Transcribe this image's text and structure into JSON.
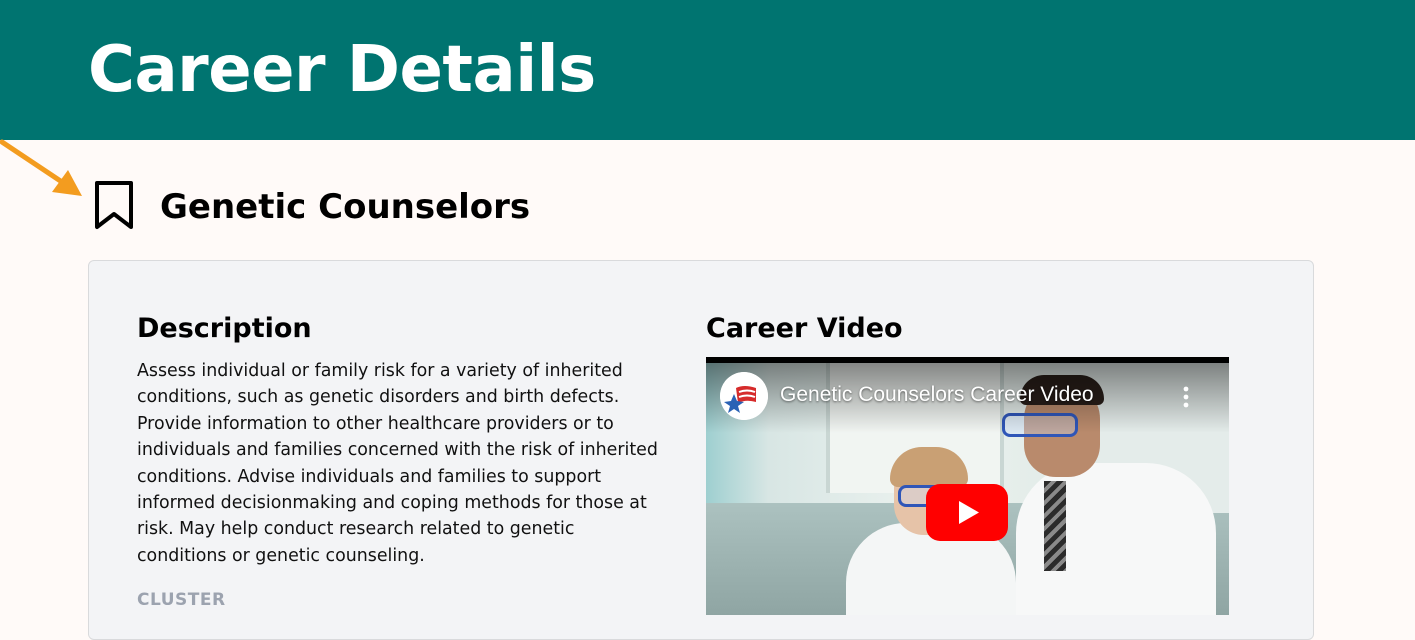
{
  "header": {
    "title": "Career Details"
  },
  "career": {
    "name": "Genetic Counselors"
  },
  "description": {
    "heading": "Description",
    "text": "Assess individual or family risk for a variety of inherited conditions, such as genetic disorders and birth defects. Provide information to other healthcare providers or to individuals and families concerned with the risk of inherited conditions. Advise individuals and families to support informed decisionmaking and coping methods for those at risk. May help conduct research related to genetic conditions or genetic counseling.",
    "cluster_label": "CLUSTER"
  },
  "video": {
    "heading": "Career Video",
    "title": "Genetic Counselors Career Video"
  },
  "colors": {
    "banner": "#007470",
    "page_bg": "#fffaf8",
    "card_bg": "#f3f4f6",
    "arrow": "#f39c1f",
    "play_red": "#ff0000"
  }
}
